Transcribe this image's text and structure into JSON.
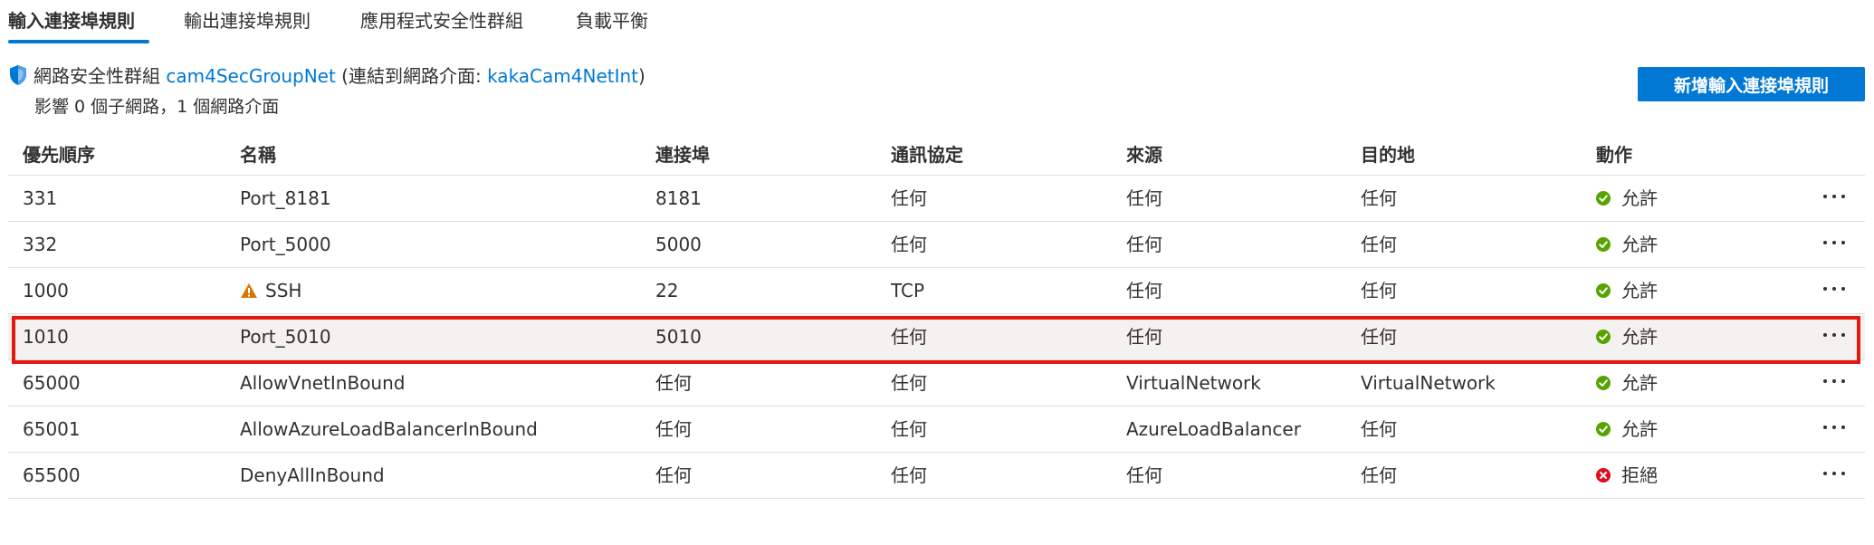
{
  "tabs": [
    {
      "label": "輸入連接埠規則",
      "active": true
    },
    {
      "label": "輸出連接埠規則",
      "active": false
    },
    {
      "label": "應用程式安全性群組",
      "active": false
    },
    {
      "label": "負載平衡",
      "active": false
    }
  ],
  "nsg": {
    "prefix": "網路安全性群組",
    "group_name": "cam4SecGroupNet",
    "attached_prefix": "(連結到網路介面: ",
    "interface_name": "kakaCam4NetInt",
    "attached_suffix": ")",
    "impact": "影響 0 個子網路，1 個網路介面"
  },
  "add_button_label": "新增輸入連接埠規則",
  "table": {
    "columns": [
      "優先順序",
      "名稱",
      "連接埠",
      "通訊協定",
      "來源",
      "目的地",
      "動作"
    ],
    "rows": [
      {
        "priority": "331",
        "name": "Port_8181",
        "port": "8181",
        "protocol": "任何",
        "source": "任何",
        "destination": "任何",
        "action": "允許",
        "status": "allow",
        "warning": false,
        "selected": false
      },
      {
        "priority": "332",
        "name": "Port_5000",
        "port": "5000",
        "protocol": "任何",
        "source": "任何",
        "destination": "任何",
        "action": "允許",
        "status": "allow",
        "warning": false,
        "selected": false
      },
      {
        "priority": "1000",
        "name": "SSH",
        "port": "22",
        "protocol": "TCP",
        "source": "任何",
        "destination": "任何",
        "action": "允許",
        "status": "allow",
        "warning": true,
        "selected": false
      },
      {
        "priority": "1010",
        "name": "Port_5010",
        "port": "5010",
        "protocol": "任何",
        "source": "任何",
        "destination": "任何",
        "action": "允許",
        "status": "allow",
        "warning": false,
        "selected": true
      },
      {
        "priority": "65000",
        "name": "AllowVnetInBound",
        "port": "任何",
        "protocol": "任何",
        "source": "VirtualNetwork",
        "destination": "VirtualNetwork",
        "action": "允許",
        "status": "allow",
        "warning": false,
        "selected": false
      },
      {
        "priority": "65001",
        "name": "AllowAzureLoadBalancerInBound",
        "port": "任何",
        "protocol": "任何",
        "source": "AzureLoadBalancer",
        "destination": "任何",
        "action": "允許",
        "status": "allow",
        "warning": false,
        "selected": false
      },
      {
        "priority": "65500",
        "name": "DenyAllInBound",
        "port": "任何",
        "protocol": "任何",
        "source": "任何",
        "destination": "任何",
        "action": "拒絕",
        "status": "deny",
        "warning": false,
        "selected": false
      }
    ]
  },
  "colors": {
    "accent": "#0078d4",
    "allow": "#57a300",
    "deny": "#e00b1c",
    "warning": "#db7500",
    "highlight": "#e11a0f"
  },
  "icons": {
    "shield": "shield-icon",
    "allow": "check-circle-icon",
    "deny": "error-circle-icon",
    "warning": "warning-icon",
    "more": "more-horizontal-icon"
  }
}
